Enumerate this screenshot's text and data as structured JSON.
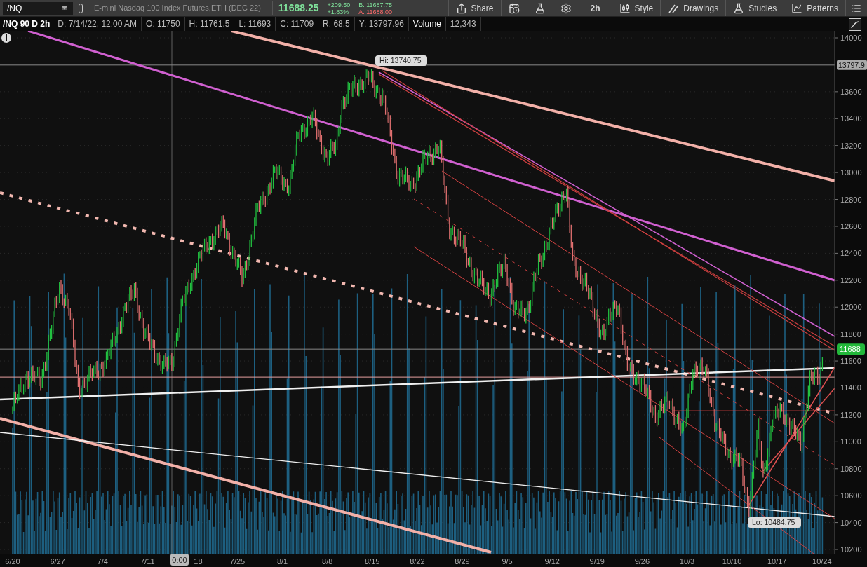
{
  "toolbar": {
    "symbol": "/NQ",
    "description": "E-mini Nasdaq 100 Index Futures,ETH (DEC 22)",
    "last": "11688.25",
    "change": "+209.50",
    "change_pct": "+1.83%",
    "bid": "B: 11687.75",
    "ask": "A: 11688.00",
    "buttons": [
      {
        "kind": "share",
        "label": "Share"
      },
      {
        "kind": "alert"
      },
      {
        "kind": "flask"
      },
      {
        "kind": "gear"
      },
      {
        "kind": "text",
        "label": "2h"
      },
      {
        "kind": "style",
        "label": "Style"
      },
      {
        "kind": "drawings",
        "label": "Drawings"
      },
      {
        "kind": "studies",
        "label": "Studies"
      },
      {
        "kind": "patterns",
        "label": "Patterns"
      }
    ]
  },
  "info": {
    "title": "/NQ 90 D 2h",
    "fields": [
      "D: 7/14/22, 12:00 AM",
      "O: 11750",
      "H: 11761.5",
      "L: 11693",
      "C: 11709",
      "R: 68.5",
      "Y: 13797.96",
      "Volume",
      "12,343"
    ]
  },
  "chart": {
    "y_labels": [
      "14000",
      "13600",
      "13400",
      "13200",
      "13000",
      "12800",
      "12600",
      "12400",
      "12200",
      "12000",
      "11800",
      "11600",
      "11400",
      "11200",
      "11000",
      "10800",
      "10600",
      "10400",
      "10200"
    ],
    "x_labels": [
      "6/20",
      "6/27",
      "7/4",
      "7/11",
      "18",
      "7/25",
      "8/1",
      "8/8",
      "8/15",
      "8/22",
      "8/29",
      "9/5",
      "9/12",
      "9/19",
      "9/26",
      "10/3",
      "10/10",
      "10/17",
      "10/24"
    ],
    "cursor_time": "0:00",
    "y_tag": "13797.9",
    "last_tag": "11688",
    "hi": "Hi: 13740.75",
    "lo": "Lo: 10484.75"
  }
}
